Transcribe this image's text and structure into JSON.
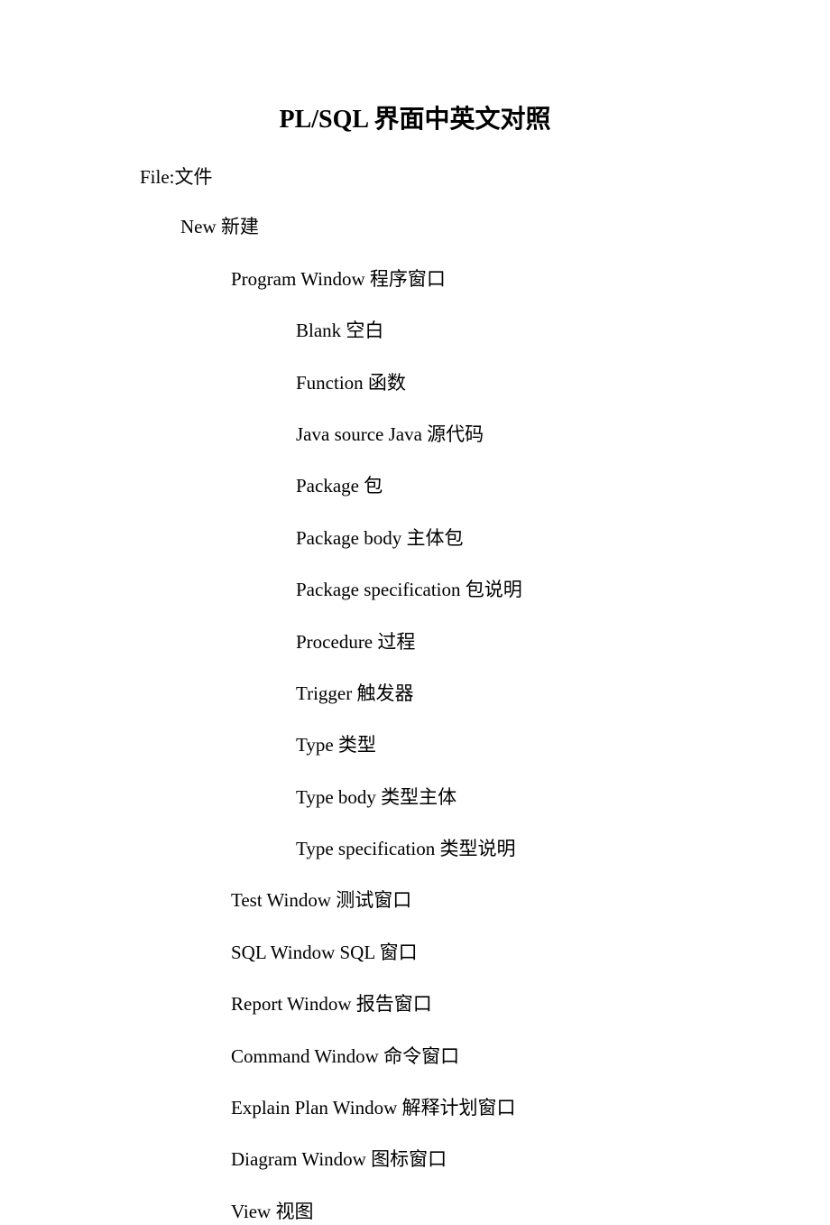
{
  "title": "PL/SQL 界面中英文对照",
  "file": "File:文件",
  "new": "New  新建",
  "program_window": "Program Window  程序窗口",
  "blank": "Blank  空白",
  "function": "Function  函数",
  "java_source": "Java source Java 源代码",
  "package": "Package    包",
  "package_body": "Package body  主体包",
  "package_specification": "Package specification  包说明",
  "procedure": "Procedure  过程",
  "trigger": "Trigger  触发器",
  "type": "Type  类型",
  "type_body": "Type body  类型主体",
  "type_specification": "Type specification  类型说明",
  "test_window": "Test Window  测试窗口",
  "sql_window": "SQL Window SQL 窗口",
  "report_window": "Report Window  报告窗口",
  "command_window": "Command Window  命令窗口",
  "explain_plan_window": "Explain Plan Window  解释计划窗口",
  "diagram_window": "Diagram Window  图标窗口",
  "view": "View  视图"
}
